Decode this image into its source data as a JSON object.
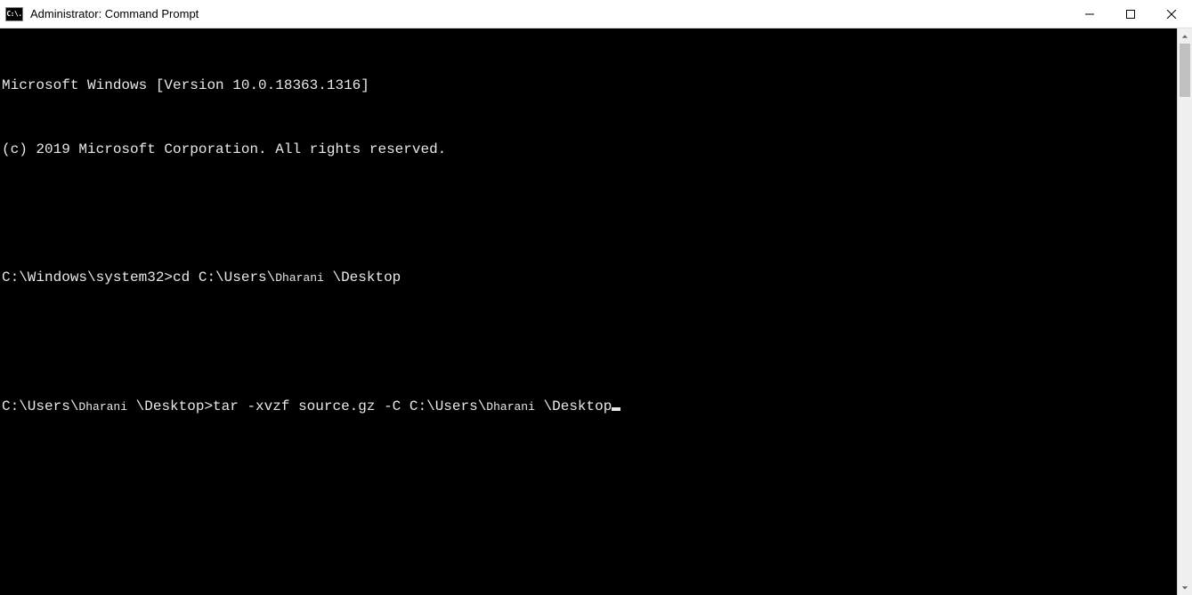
{
  "window": {
    "title": "Administrator: Command Prompt",
    "icon_label": "C:\\."
  },
  "terminal": {
    "version_line": "Microsoft Windows [Version 10.0.18363.1316]",
    "copyright_line": "(c) 2019 Microsoft Corporation. All rights reserved.",
    "username_small": "Dharani",
    "line1_a": "C:\\Windows\\system32>cd C:\\Users\\",
    "line1_b": " \\Desktop",
    "line2_a": "C:\\Users\\",
    "line2_b": " \\Desktop>tar -xvzf source.gz -C C:\\Users\\",
    "line2_c": " \\Desktop"
  }
}
